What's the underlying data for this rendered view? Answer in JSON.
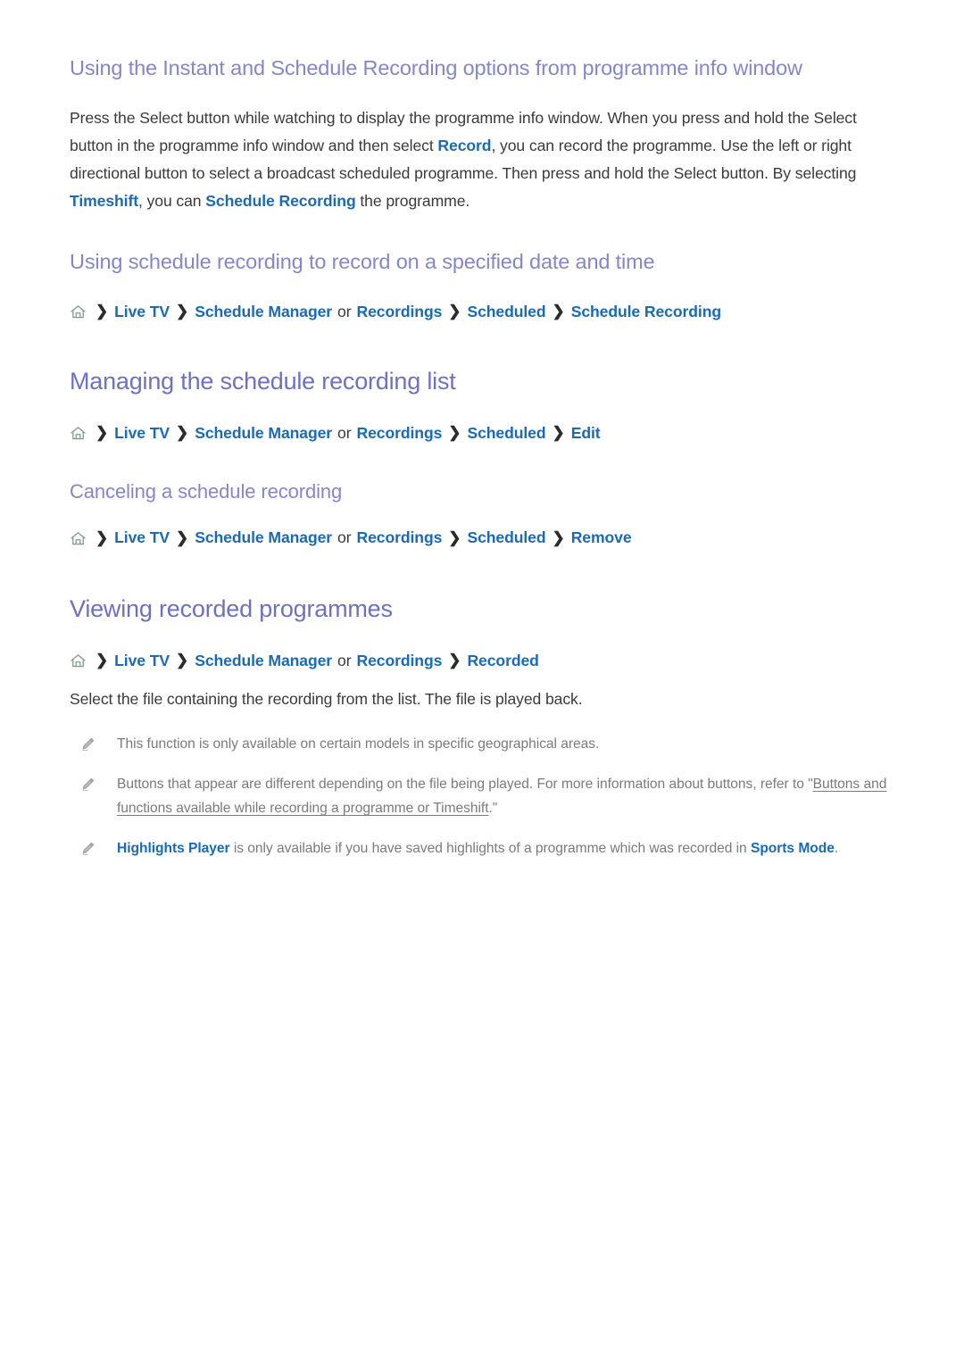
{
  "sections": {
    "instant_schedule": {
      "heading": "Using the Instant and Schedule Recording options from programme info window",
      "paragraph": {
        "t1": "Press the Select button while watching to display the programme info window. When you press and hold the Select button in the programme info window and then select ",
        "link1": "Record",
        "t2": ", you can record the programme. Use the left or right directional button to select a broadcast scheduled programme. Then press and hold the Select button. By selecting ",
        "link2": "Timeshift",
        "t3": ", you can ",
        "link3": "Schedule Recording",
        "t4": " the programme."
      }
    },
    "specified_date": {
      "heading": "Using schedule recording to record on a specified date and time",
      "breadcrumb": {
        "home_icon": "home-icon",
        "separator": "❯",
        "n1": "Live TV",
        "n2": "Schedule Manager",
        "conj": "or",
        "n3": "Recordings",
        "n4": "Scheduled",
        "n5": "Schedule Recording"
      }
    },
    "managing_list": {
      "heading": "Managing the schedule recording list",
      "breadcrumb": {
        "home_icon": "home-icon",
        "separator": "❯",
        "n1": "Live TV",
        "n2": "Schedule Manager",
        "conj": "or",
        "n3": "Recordings",
        "n4": "Scheduled",
        "n5": "Edit"
      }
    },
    "canceling": {
      "heading": "Canceling a schedule recording",
      "breadcrumb": {
        "home_icon": "home-icon",
        "separator": "❯",
        "n1": "Live TV",
        "n2": "Schedule Manager",
        "conj": "or",
        "n3": "Recordings",
        "n4": "Scheduled",
        "n5": "Remove"
      }
    },
    "viewing_recorded": {
      "heading": "Viewing recorded programmes",
      "breadcrumb": {
        "home_icon": "home-icon",
        "separator": "❯",
        "n1": "Live TV",
        "n2": "Schedule Manager",
        "conj": "or",
        "n3": "Recordings",
        "n4": "Recorded"
      },
      "paragraph": "Select the file containing the recording from the list. The file is played back.",
      "notes": [
        {
          "icon": "pencil-icon",
          "t1": "This function is only available on certain models in specific geographical areas."
        },
        {
          "icon": "pencil-icon",
          "t1": "Buttons that appear are different depending on the file being played. For more information about buttons, refer to \"",
          "underline": "Buttons and functions available while recording a programme or Timeshift",
          "t2": ".\""
        },
        {
          "icon": "pencil-icon",
          "blue1": "Highlights Player",
          "t1": " is only available if you have saved highlights of a programme which was recorded in ",
          "blue2": "Sports Mode",
          "t2": "."
        }
      ]
    }
  },
  "colors": {
    "heading_h2": "#6e71c2",
    "heading_h3": "#8486c9",
    "link_blue": "#1a6ab4",
    "note_gray": "#7b7b7b",
    "body_text": "#3a3a3a",
    "home_icon": "#7f9f8f"
  }
}
